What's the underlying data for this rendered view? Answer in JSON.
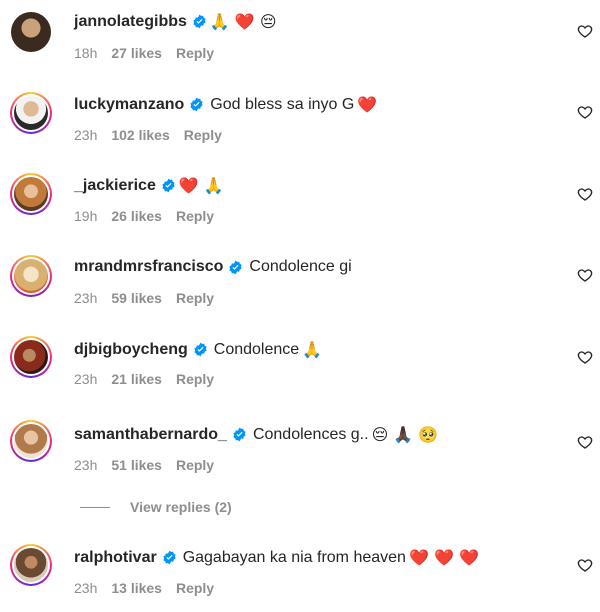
{
  "comments": [
    {
      "username": "jannolategibbs",
      "text": "",
      "emojis": "🙏 ❤️ 😔",
      "time": "18h",
      "likes": "27 likes",
      "reply": "Reply",
      "ring": false
    },
    {
      "username": "luckymanzano",
      "text": "God bless sa inyo G",
      "emojis": "❤️",
      "time": "23h",
      "likes": "102 likes",
      "reply": "Reply",
      "ring": true
    },
    {
      "username": "_jackierice",
      "text": "",
      "emojis": "❤️ 🙏",
      "time": "19h",
      "likes": "26 likes",
      "reply": "Reply",
      "ring": true
    },
    {
      "username": "mrandmrsfrancisco",
      "text": "Condolence gi",
      "emojis": "",
      "time": "23h",
      "likes": "59 likes",
      "reply": "Reply",
      "ring": true
    },
    {
      "username": "djbigboycheng",
      "text": "Condolence",
      "emojis": "🙏",
      "time": "23h",
      "likes": "21 likes",
      "reply": "Reply",
      "ring": true
    },
    {
      "username": "samanthabernardo_",
      "text": "Condolences g..",
      "emojis": "😔 🙏🏿 🥺",
      "time": "23h",
      "likes": "51 likes",
      "reply": "Reply",
      "ring": true
    },
    {
      "username": "ralphotivar",
      "text": "Gagabayan ka nia from heaven",
      "emojis": "❤️ ❤️ ❤️",
      "time": "23h",
      "likes": "13 likes",
      "reply": "Reply",
      "ring": true
    }
  ],
  "view_replies": "View replies (2)",
  "icons": {
    "verified": "verified-badge-icon",
    "like": "heart-outline-icon"
  },
  "colors": {
    "verified": "#0095f6",
    "muted": "#8e8e8e",
    "text": "#262626"
  }
}
